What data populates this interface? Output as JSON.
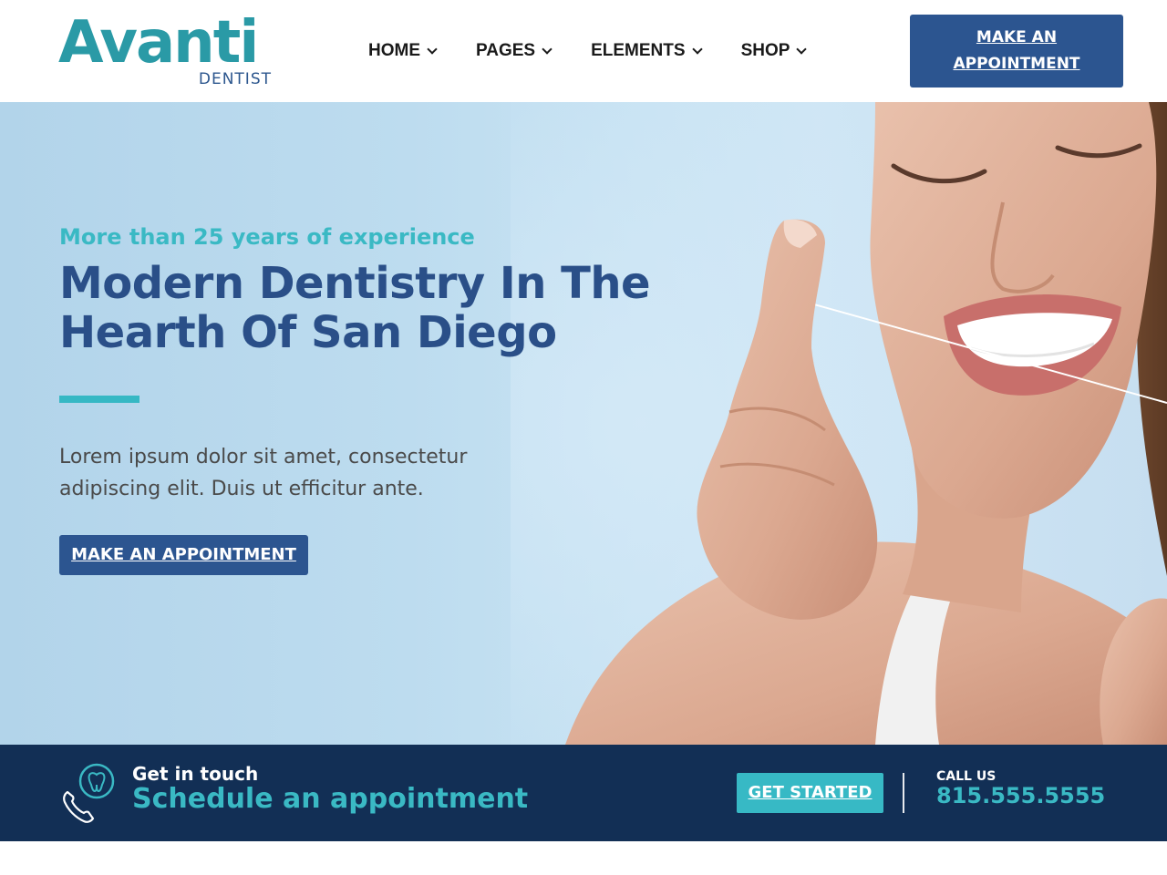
{
  "header": {
    "logo_main": "Avanti",
    "logo_sub": "DENTIST",
    "nav": [
      {
        "label": "HOME"
      },
      {
        "label": "PAGES"
      },
      {
        "label": "ELEMENTS"
      },
      {
        "label": "SHOP"
      }
    ],
    "cta_line1": "MAKE AN",
    "cta_line2": "APPOINTMENT"
  },
  "hero": {
    "eyebrow": "More than 25 years of experience",
    "headline_line1": "Modern Dentistry In The",
    "headline_line2": "Hearth Of San Diego",
    "lead_line1": "Lorem ipsum dolor sit amet, consectetur",
    "lead_line2": "adipiscing elit. Duis ut efficitur ante.",
    "button": "MAKE AN APPOINTMENT"
  },
  "cta_bar": {
    "small": "Get in touch",
    "big": "Schedule an appointment",
    "button": "GET STARTED",
    "call_label": "CALL US",
    "phone": "815.555.5555",
    "icon": "phone-tooth-icon"
  },
  "colors": {
    "brand_teal": "#3ab9c4",
    "brand_navy": "#2c5590",
    "bar_navy": "#122f55"
  }
}
